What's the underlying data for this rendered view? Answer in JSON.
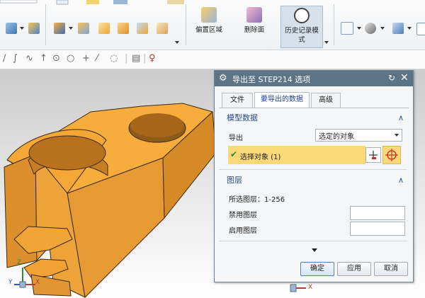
{
  "ribbon": {
    "buttons": {
      "reposition_area": "偏置区域",
      "delete_face": "删除面",
      "history_mode_line1": "历史记录模",
      "history_mode_line2": "式"
    }
  },
  "dialog": {
    "title": "导出至 STEP214 选项",
    "tabs": [
      "文件",
      "要导出的数据",
      "高级"
    ],
    "selected_tab": "要导出的数据",
    "model_data": {
      "heading": "模型数据",
      "export_label": "导出",
      "export_value": "选定的对象",
      "select_object_label": "选择对象 (1)"
    },
    "layers": {
      "heading": "图层",
      "selected_layers_label": "所选图层：1-256",
      "disabled_layers_label": "禁用图层",
      "enabled_layers_label": "启用图层",
      "disabled_layers_value": "",
      "enabled_layers_value": ""
    },
    "buttons": {
      "ok": "确定",
      "apply": "应用",
      "cancel": "取消"
    }
  },
  "triad": {
    "x": "X",
    "y": "Y",
    "z": "Z"
  },
  "colors": {
    "part_face": "#f6ad3c",
    "part_dark": "#d58d2c",
    "highlight_row": "#fbd878",
    "dialog_title_bar": "#5d7487",
    "section_heading": "#2e4f8e"
  }
}
